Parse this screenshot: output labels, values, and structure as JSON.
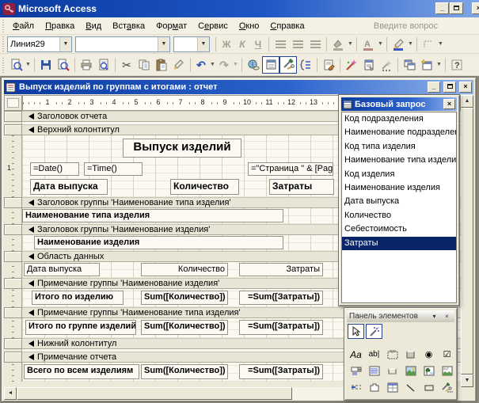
{
  "app": {
    "title": "Microsoft Access",
    "minimize_glyph": "_",
    "menus": [
      "Файл",
      "Правка",
      "Вид",
      "Вставка",
      "Формат",
      "Сервис",
      "Окно",
      "Справка"
    ],
    "menu_underline": [
      0,
      0,
      0,
      3,
      3,
      1,
      0,
      0
    ],
    "ask_question": "Введите вопрос"
  },
  "format_toolbar": {
    "object_name": "Линия29",
    "font_name": "",
    "font_size": "",
    "bold": "Ж",
    "italic": "К",
    "underline": "Ч"
  },
  "report_window": {
    "title": "Выпуск изделий по группам с итогами : отчет",
    "minimize_glyph": "_",
    "close_glyph": "×",
    "ruler": [
      "1",
      "2",
      "3",
      "4",
      "5",
      "6",
      "7",
      "8",
      "9",
      "10",
      "11",
      "12",
      "13"
    ],
    "vertical_ruler_1": "1"
  },
  "design": {
    "sections": {
      "report_header": "Заголовок отчета",
      "page_header": "Верхний колонтитул",
      "group_header_type": "Заголовок группы 'Наименование типа изделия'",
      "group_header_item": "Заголовок группы 'Наименование изделия'",
      "detail": "Область данных",
      "group_footer_item": "Примечание группы 'Наименование изделия'",
      "group_footer_type": "Примечание группы 'Наименование типа изделия'",
      "page_footer": "Нижний колонтитул",
      "report_footer": "Примечание отчета"
    },
    "controls": {
      "report_title": "Выпуск изделий",
      "date": "=Date()",
      "time": "=Time()",
      "page": "=\"Страница \" & [Page]",
      "col_date": "Дата выпуска",
      "col_qty": "Количество",
      "col_cost": "Затраты",
      "type_name": "Наименование типа изделия",
      "item_name": "Наименование изделия",
      "detail_date": "Дата выпуска",
      "detail_qty": "Количество",
      "detail_cost": "Затраты",
      "item_total_label": "Итого по изделию",
      "group_total_label": "Итого по группе изделий",
      "grand_total_label": "Всего по всем изделиям",
      "sum_qty": "Sum([Количество])",
      "sum_cost": "=Sum([Затраты])"
    }
  },
  "field_list": {
    "title": "Базовый запрос",
    "close_glyph": "×",
    "fields": [
      "Код подразделения",
      "Наименование подразделения",
      "Код типа изделия",
      "Наименование типа изделия",
      "Код изделия",
      "Наименование изделия",
      "Дата выпуска",
      "Количество",
      "Себестоимость",
      "Затраты"
    ],
    "selected_field": "Затраты"
  },
  "toolbox": {
    "title": "Панель элементов",
    "options_glyph": "▾",
    "close_glyph": "×",
    "label_glyph": "Aa",
    "textbox_glyph": "ab|",
    "option_button_glyph": "◉",
    "checkbox_glyph": "☑"
  },
  "colors": {
    "selection": "#0A246A",
    "titlebar": "#0B3BA0",
    "chrome": "#ECE9D8"
  }
}
